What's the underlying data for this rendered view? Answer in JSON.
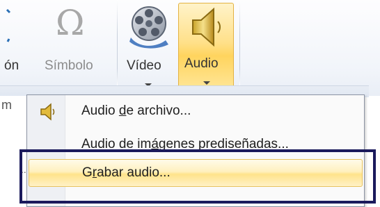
{
  "ribbon": {
    "partial_label": "ón",
    "symbol_label": "Símbolo",
    "video_label": "Vídeo",
    "audio_label": "Audio",
    "left_fragment": "m"
  },
  "menu": {
    "items": [
      {
        "label_pre": "Audio ",
        "label_u": "d",
        "label_post": "e archivo...",
        "icon": "speaker-icon"
      },
      {
        "label_pre": "Audio de im",
        "label_u": "á",
        "label_post": "genes prediseñadas...",
        "icon": ""
      },
      {
        "label_pre": "G",
        "label_u": "r",
        "label_post": "abar audio...",
        "icon": ""
      }
    ],
    "ellipsis": "..."
  },
  "colors": {
    "highlight_frame": "#1b1a5c",
    "hover_bg": "#ffe38b"
  }
}
